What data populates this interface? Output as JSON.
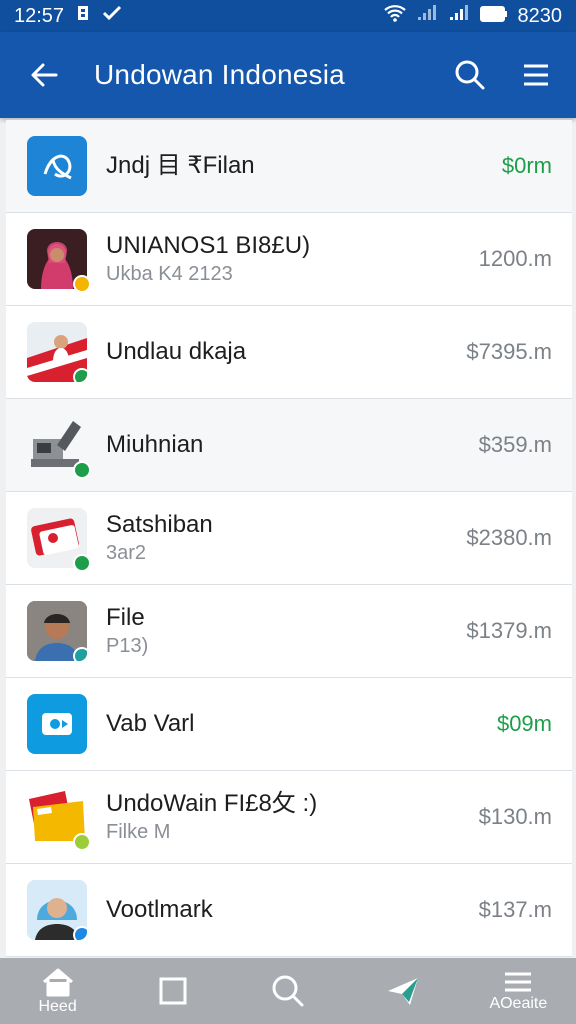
{
  "status_bar": {
    "time": "12:57",
    "battery_text": "8230"
  },
  "header": {
    "title": "Undowan Indonesia"
  },
  "items": [
    {
      "name": "Jndj 目 ₹Filan",
      "sub": "",
      "amount": "$0rm",
      "amount_color": "green"
    },
    {
      "name": "UNIANOS1 BI8£U)",
      "sub": "Ukba K4 2123",
      "amount": "1200.m",
      "amount_color": "gray"
    },
    {
      "name": "Undlau dkaja",
      "sub": "",
      "amount": "$7395.m",
      "amount_color": "gray"
    },
    {
      "name": "Miuhnian",
      "sub": "",
      "amount": "$359.m",
      "amount_color": "gray"
    },
    {
      "name": "Satshiban",
      "sub": "3ar2",
      "amount": "$2380.m",
      "amount_color": "gray"
    },
    {
      "name": "File",
      "sub": "P13)",
      "amount": "$1379.m",
      "amount_color": "gray"
    },
    {
      "name": "Vab Varl",
      "sub": "",
      "amount": "$09m",
      "amount_color": "green"
    },
    {
      "name": "UndoWain FI£8攵 :)",
      "sub": "Filke M",
      "amount": "$130.m",
      "amount_color": "gray"
    },
    {
      "name": "Vootlmark",
      "sub": "",
      "amount": "$137.m",
      "amount_color": "gray"
    }
  ],
  "bottom_nav": [
    {
      "label": "Heed",
      "icon": "home-icon"
    },
    {
      "label": "",
      "icon": "square-icon"
    },
    {
      "label": "",
      "icon": "search-icon"
    },
    {
      "label": "",
      "icon": "send-icon"
    },
    {
      "label": "AOeaite",
      "icon": "menu-icon"
    }
  ],
  "colors": {
    "status_bar": "#0f4f9e",
    "app_bar": "#1557ad",
    "green": "#1e9e4a",
    "bottom_bar": "#a9acb1"
  }
}
